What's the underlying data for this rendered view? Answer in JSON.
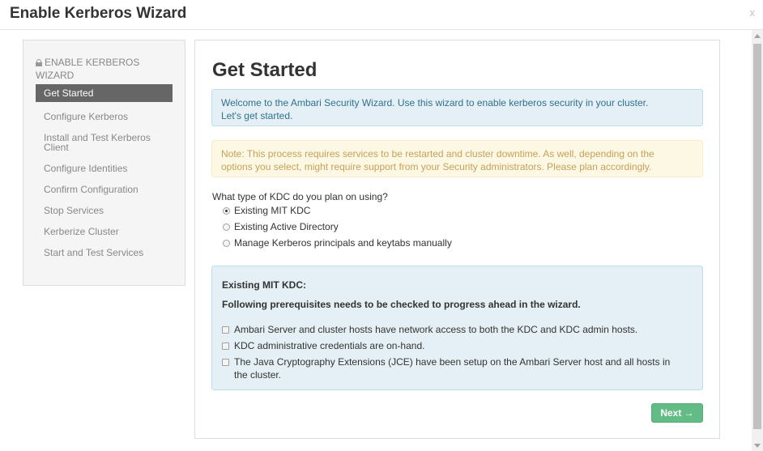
{
  "window": {
    "title": "Enable Kerberos Wizard",
    "close_label": "x"
  },
  "sidebar": {
    "header": "ENABLE KERBEROS WIZARD",
    "items": [
      {
        "label": "Get Started",
        "active": true
      },
      {
        "label": "Configure Kerberos"
      },
      {
        "label": "Install and Test Kerberos Client"
      },
      {
        "label": "Configure Identities"
      },
      {
        "label": "Confirm Configuration"
      },
      {
        "label": "Stop Services"
      },
      {
        "label": "Kerberize Cluster"
      },
      {
        "label": "Start and Test Services"
      }
    ]
  },
  "main": {
    "title": "Get Started",
    "info_line1": "Welcome to the Ambari Security Wizard. Use this wizard to enable kerberos security in your cluster.",
    "info_line2": "Let's get started.",
    "warning_line1": "Note: This process requires services to be restarted and cluster downtime. As well, depending on the",
    "warning_line2": "options you select, might require support from your Security administrators. Please plan accordingly.",
    "kdc_question": "What type of KDC do you plan on using?",
    "kdc_options": [
      {
        "label": "Existing MIT KDC",
        "checked": true
      },
      {
        "label": "Existing Active Directory",
        "checked": false
      },
      {
        "label": "Manage Kerberos principals and keytabs manually",
        "checked": false
      }
    ],
    "prereq": {
      "title": "Existing MIT KDC:",
      "subtitle": "Following prerequisites needs to be checked to progress ahead in the wizard.",
      "items": [
        {
          "label": "Ambari Server and cluster hosts have network access to both the KDC and KDC admin hosts.",
          "checked": false
        },
        {
          "label": "KDC administrative credentials are on-hand.",
          "checked": false
        },
        {
          "label": "The Java Cryptography Extensions (JCE) have been setup on the Ambari Server host and all hosts in the cluster.",
          "checked": false
        }
      ]
    },
    "next_label": "Next →"
  },
  "colors": {
    "active_nav_bg": "#666666",
    "info_bg": "#e4f0f5",
    "warning_bg": "#fcf8e3",
    "warning_text": "#c7a05a",
    "next_button_bg": "#63bb86"
  }
}
